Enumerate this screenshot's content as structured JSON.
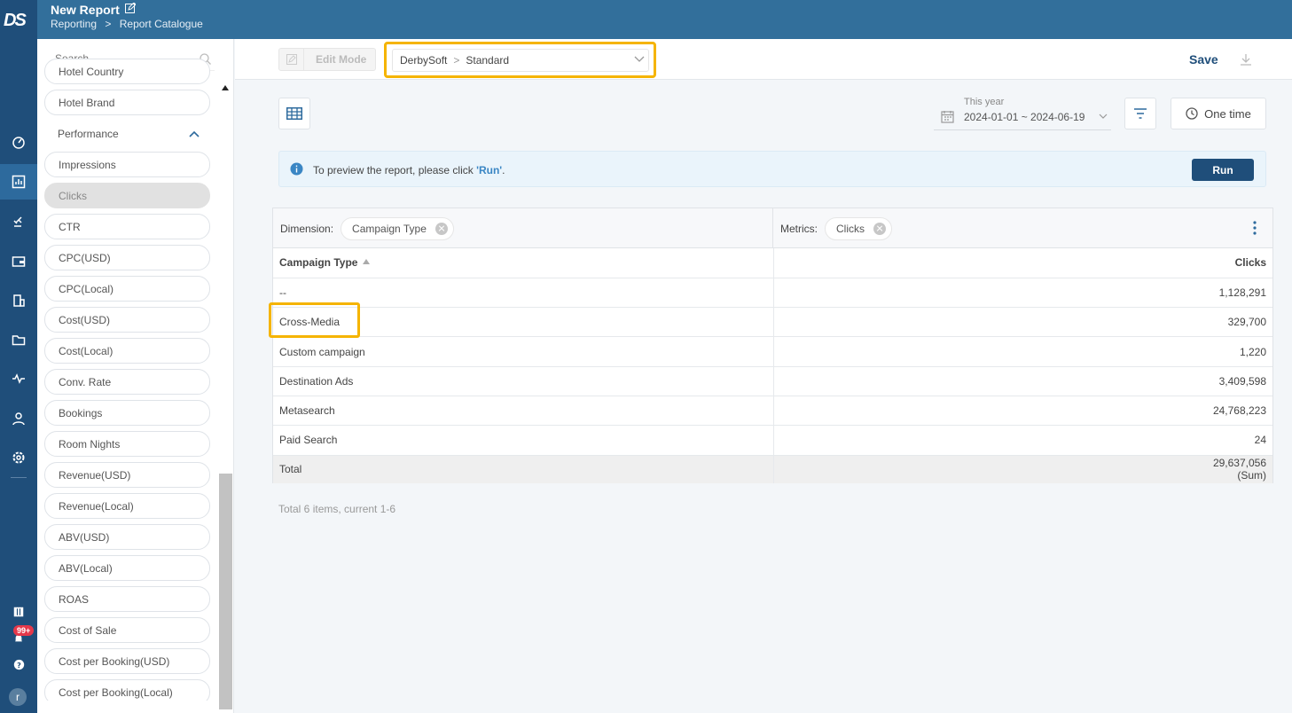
{
  "app": {
    "logo_text": "DS",
    "title": "New Report",
    "breadcrumbs": [
      "Reporting",
      ">",
      "Report Catalogue"
    ]
  },
  "rail": {
    "badge": "99+",
    "avatar": "r",
    "icons": [
      "dashboard-icon",
      "report-icon",
      "bid-icon",
      "wallet-icon",
      "hotel-icon",
      "folder-icon",
      "activity-icon",
      "user-icon",
      "settings-icon",
      "grid-small-icon",
      "bell-icon",
      "help-icon"
    ]
  },
  "sidebar": {
    "search_placeholder": "Search",
    "items": [
      {
        "label": "Hotel Country",
        "type": "pill"
      },
      {
        "label": "Hotel Brand",
        "type": "pill"
      },
      {
        "label": "Performance",
        "type": "group"
      },
      {
        "label": "Impressions",
        "type": "pill"
      },
      {
        "label": "Clicks",
        "type": "selected"
      },
      {
        "label": "CTR",
        "type": "pill"
      },
      {
        "label": "CPC(USD)",
        "type": "pill"
      },
      {
        "label": "CPC(Local)",
        "type": "pill"
      },
      {
        "label": "Cost(USD)",
        "type": "pill"
      },
      {
        "label": "Cost(Local)",
        "type": "pill"
      },
      {
        "label": "Conv. Rate",
        "type": "pill"
      },
      {
        "label": "Bookings",
        "type": "pill"
      },
      {
        "label": "Room Nights",
        "type": "pill"
      },
      {
        "label": "Revenue(USD)",
        "type": "pill"
      },
      {
        "label": "Revenue(Local)",
        "type": "pill"
      },
      {
        "label": "ABV(USD)",
        "type": "pill"
      },
      {
        "label": "ABV(Local)",
        "type": "pill"
      },
      {
        "label": "ROAS",
        "type": "pill"
      },
      {
        "label": "Cost of Sale",
        "type": "pill"
      },
      {
        "label": "Cost per Booking(USD)",
        "type": "pill"
      },
      {
        "label": "Cost per Booking(Local)",
        "type": "pill"
      }
    ]
  },
  "toolbar": {
    "edit_mode": "Edit Mode",
    "selector_org": "DerbySoft",
    "selector_sep": ">",
    "selector_template": "Standard",
    "save": "Save"
  },
  "controls": {
    "date_label": "This year",
    "date_value": "2024-01-01 ~ 2024-06-19",
    "schedule": "One time"
  },
  "info": {
    "text_before": "To preview the report, please click ",
    "run_link": "'Run'",
    "text_after": ".",
    "run_button": "Run"
  },
  "report": {
    "dimension_label": "Dimension:",
    "dimension_chip": "Campaign Type",
    "metrics_label": "Metrics:",
    "metrics_chip": "Clicks",
    "col_dimension": "Campaign Type",
    "col_metric": "Clicks",
    "rows": [
      {
        "type": "--",
        "clicks": "1,128,291"
      },
      {
        "type": "Cross-Media",
        "clicks": "329,700"
      },
      {
        "type": "Custom campaign",
        "clicks": "1,220"
      },
      {
        "type": "Destination Ads",
        "clicks": "3,409,598"
      },
      {
        "type": "Metasearch",
        "clicks": "24,768,223"
      },
      {
        "type": "Paid Search",
        "clicks": "24"
      }
    ],
    "total_label": "Total",
    "total_value": "29,637,056",
    "total_note": "(Sum)",
    "footer": "Total 6 items, current 1-6"
  },
  "colors": {
    "rail": "#1f4e7a",
    "header": "#326f9b",
    "highlight": "#f5b400",
    "primary": "#1f4e7a"
  }
}
